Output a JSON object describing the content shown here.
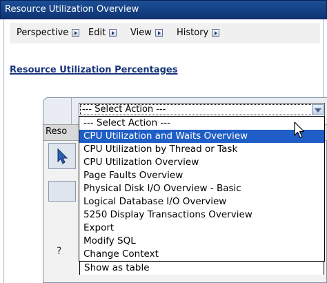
{
  "window": {
    "title": "Resource Utilization Overview"
  },
  "menubar": {
    "items": [
      {
        "label": "Perspective"
      },
      {
        "label": "Edit"
      },
      {
        "label": "View"
      },
      {
        "label": "History"
      }
    ]
  },
  "section": {
    "title": "Resource Utilization Percentages"
  },
  "panel": {
    "tab_label": "Reso",
    "side_mark": "?"
  },
  "action_select": {
    "value": "--- Select Action ---",
    "options": [
      "--- Select Action ---",
      "CPU Utilization and Waits Overview",
      "CPU Utilization by Thread or Task",
      "CPU Utilization Overview",
      "Page Faults Overview",
      "Physical Disk I/O Overview - Basic",
      "Logical Database I/O Overview",
      "5250 Display Transactions Overview",
      "Export",
      "Modify SQL",
      "Change Context",
      "Show as table"
    ],
    "highlighted": "CPU Utilization and Waits Overview"
  },
  "colors": {
    "title_bar": "#1d4f96",
    "highlight": "#1f5ec6",
    "section_title": "#17347a"
  },
  "icons": [
    "menu-arrow-icon",
    "dropdown-arrow-icon",
    "pointer-cursor-icon",
    "select-tool-icon"
  ]
}
